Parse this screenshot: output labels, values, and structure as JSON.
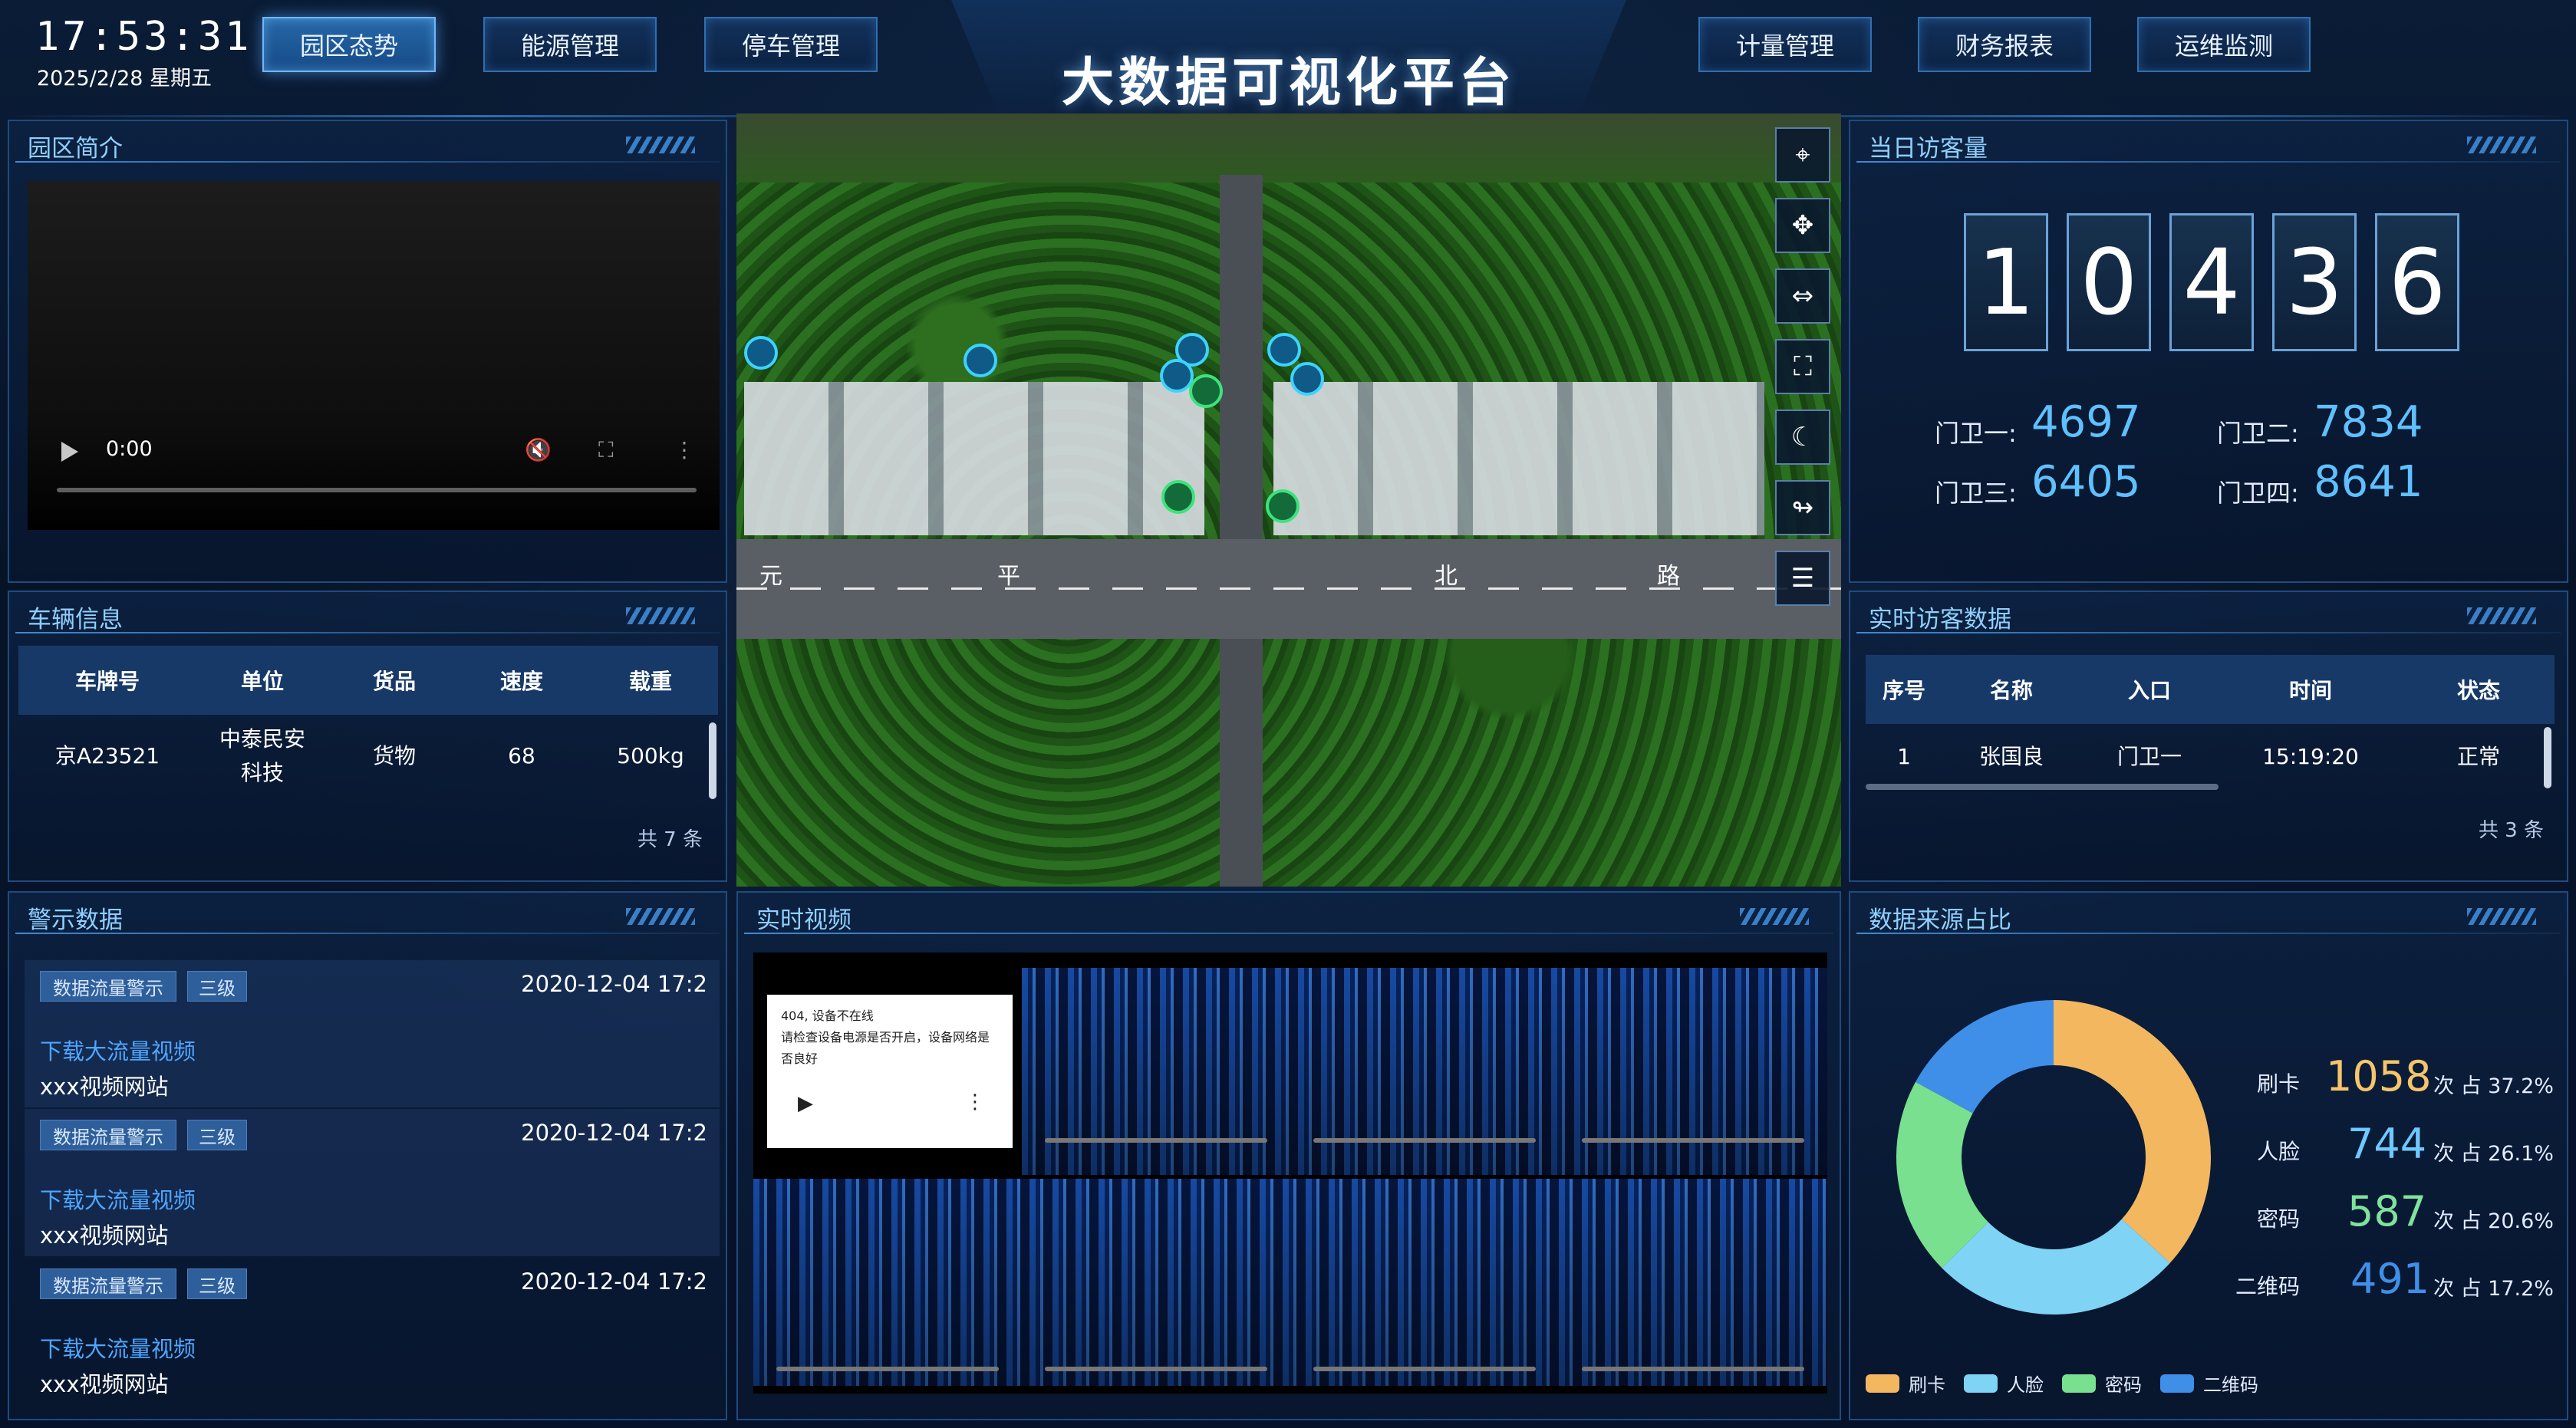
{
  "header": {
    "time": "17:53:31",
    "date": "2025/2/28 星期五",
    "title": "大数据可视化平台",
    "nav_left": [
      "园区态势",
      "能源管理",
      "停车管理"
    ],
    "nav_right": [
      "计量管理",
      "财务报表",
      "运维监测"
    ],
    "active_nav": "园区态势"
  },
  "intro": {
    "title": "园区简介",
    "video_time": "0:00"
  },
  "vehicles": {
    "title": "车辆信息",
    "columns": [
      "车牌号",
      "单位",
      "货品",
      "速度",
      "载重"
    ],
    "rows": [
      [
        "京A23521",
        "中泰民安科技",
        "货物",
        "68",
        "500kg"
      ]
    ],
    "unit_line1": "中泰民安",
    "unit_line2": "科技",
    "footer": "共 7 条"
  },
  "warnings": {
    "title": "警示数据",
    "items": [
      {
        "tag1": "数据流量警示",
        "tag2": "三级",
        "time": "2020-12-04 17:2",
        "link": "下载大流量视频",
        "site": "xxx视频网站"
      },
      {
        "tag1": "数据流量警示",
        "tag2": "三级",
        "time": "2020-12-04 17:2",
        "link": "下载大流量视频",
        "site": "xxx视频网站"
      },
      {
        "tag1": "数据流量警示",
        "tag2": "三级",
        "time": "2020-12-04 17:2",
        "link": "下载大流量视频",
        "site": "xxx视频网站"
      }
    ]
  },
  "map": {
    "road_chars": [
      "元",
      "平",
      "北",
      "路"
    ],
    "tools": [
      "target-icon",
      "move-icon",
      "measure-icon",
      "fullscreen-icon",
      "night-icon",
      "route-icon",
      "layers-icon"
    ]
  },
  "visitors_today": {
    "title": "当日访客量",
    "digits": [
      "1",
      "0",
      "4",
      "3",
      "6"
    ],
    "gates": [
      {
        "label": "门卫一:",
        "value": "4697"
      },
      {
        "label": "门卫二:",
        "value": "7834"
      },
      {
        "label": "门卫三:",
        "value": "6405"
      },
      {
        "label": "门卫四:",
        "value": "8641"
      }
    ]
  },
  "live_visitors": {
    "title": "实时访客数据",
    "columns": [
      "序号",
      "名称",
      "入口",
      "时间",
      "状态"
    ],
    "rows": [
      [
        "1",
        "张国良",
        "门卫一",
        "15:19:20",
        "正常"
      ]
    ],
    "footer": "共 3 条"
  },
  "live_video": {
    "title": "实时视频",
    "offline_line1": "404, 设备不在线",
    "offline_line2": "请检查设备电源是否开启，设备网络是否良好"
  },
  "sources": {
    "title": "数据来源占比",
    "items": [
      {
        "label": "刷卡",
        "value": "1058",
        "pct": "次 占 37.2%",
        "color": "#f3b760"
      },
      {
        "label": "人脸",
        "value": "744",
        "pct": "次 占 26.1%",
        "color": "#7fd3f4"
      },
      {
        "label": "密码",
        "value": "587",
        "pct": "次 占 20.6%",
        "color": "#78e08f"
      },
      {
        "label": "二维码",
        "value": "491",
        "pct": "次 占 17.2%",
        "color": "#3f8fe8"
      }
    ]
  },
  "chart_data": {
    "type": "pie",
    "categories": [
      "刷卡",
      "人脸",
      "密码",
      "二维码"
    ],
    "values": [
      1058,
      744,
      587,
      491
    ],
    "percentages": [
      37.2,
      26.1,
      20.6,
      17.2
    ],
    "colors": [
      "#f3b760",
      "#7fd3f4",
      "#78e08f",
      "#3f8fe8"
    ],
    "legend_position": "bottom",
    "donut": true
  }
}
